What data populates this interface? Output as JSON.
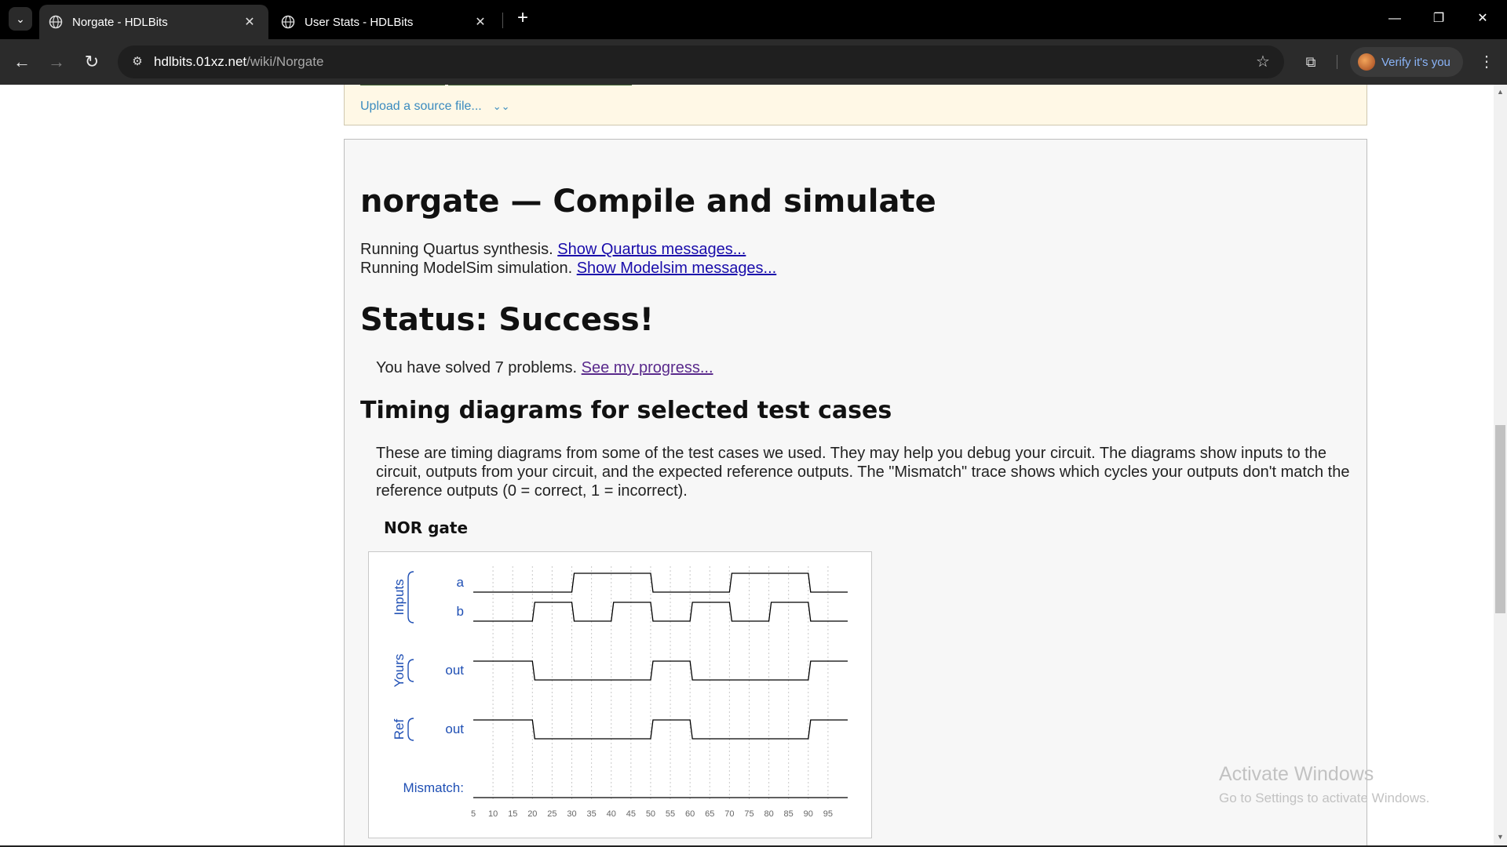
{
  "browser": {
    "tabs": [
      {
        "title": "Norgate - HDLBits",
        "active": true
      },
      {
        "title": "User Stats - HDLBits",
        "active": false
      }
    ],
    "url_host": "hdlbits.01xz.net",
    "url_path": "/wiki/Norgate",
    "profile_label": "Verify it's you"
  },
  "upload": {
    "link_label": "Upload a source file..."
  },
  "result": {
    "heading": "norgate — Compile and simulate",
    "quartus_text": "Running Quartus synthesis. ",
    "quartus_link": "Show Quartus messages...",
    "modelsim_text": "Running ModelSim simulation. ",
    "modelsim_link": "Show Modelsim messages...",
    "status": "Status: Success!",
    "solved_text": "You have solved 7 problems. ",
    "progress_link": "See my progress...",
    "timing_heading": "Timing diagrams for selected test cases",
    "timing_desc": "These are timing diagrams from some of the test cases we used. They may help you debug your circuit. The diagrams show inputs to the circuit, outputs from your circuit, and the expected reference outputs. The \"Mismatch\" trace shows which cycles your outputs don't match the reference outputs (0 = correct, 1 = incorrect)."
  },
  "timing_diagram": {
    "title": "NOR gate",
    "groups": [
      {
        "label": "Inputs"
      },
      {
        "label": "Yours"
      },
      {
        "label": "Ref"
      }
    ],
    "signals": [
      {
        "name": "a",
        "group": "Inputs",
        "values": [
          0,
          0,
          0,
          0,
          0,
          1,
          1,
          1,
          1,
          0,
          0,
          0,
          0,
          1,
          1,
          1,
          1,
          0,
          0
        ]
      },
      {
        "name": "b",
        "group": "Inputs",
        "values": [
          0,
          0,
          0,
          1,
          1,
          0,
          0,
          1,
          1,
          0,
          0,
          1,
          1,
          0,
          0,
          1,
          1,
          0,
          0
        ]
      },
      {
        "name": "out",
        "group": "Yours",
        "values": [
          1,
          1,
          1,
          0,
          0,
          0,
          0,
          0,
          0,
          1,
          1,
          0,
          0,
          0,
          0,
          0,
          0,
          1,
          1
        ]
      },
      {
        "name": "out",
        "group": "Ref",
        "values": [
          1,
          1,
          1,
          0,
          0,
          0,
          0,
          0,
          0,
          1,
          1,
          0,
          0,
          0,
          0,
          0,
          0,
          1,
          1
        ]
      }
    ],
    "mismatch_label": "Mismatch:",
    "mismatch_values": [
      0,
      0,
      0,
      0,
      0,
      0,
      0,
      0,
      0,
      0,
      0,
      0,
      0,
      0,
      0,
      0,
      0,
      0,
      0
    ],
    "ticks": [
      "5",
      "10",
      "15",
      "20",
      "25",
      "30",
      "35",
      "40",
      "45",
      "50",
      "55",
      "60",
      "65",
      "70",
      "75",
      "80",
      "85",
      "90",
      "95"
    ],
    "colors": {
      "label": "#1f4fb4",
      "trace": "#000000",
      "grid": "#c8c8c8"
    }
  },
  "watermark": {
    "line1": "Activate Windows",
    "line2": "Go to Settings to activate Windows."
  }
}
